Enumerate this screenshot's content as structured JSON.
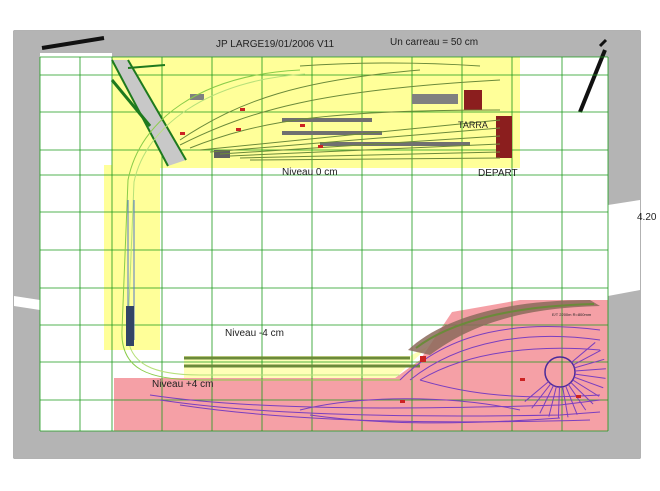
{
  "plan": {
    "title": "JP LARGE19/01/2006 V11",
    "scale_note": "Un carreau = 50 cm",
    "dimension": "4.20",
    "labels": {
      "level_0": "Niveau 0 cm",
      "level_minus4": "Niveau -4 cm",
      "level_plus4": "Niveau +4 cm",
      "depart": "DEPART",
      "building_mark": "TARRA",
      "small_note": "E/T 2200m  R=800mm"
    },
    "colors": {
      "room_wall": "#b4b4b4",
      "floor": "#ffffff",
      "level_0_zone": "#ffff99",
      "level_plus4_zone": "#f5a0a6",
      "grid": "#1a9a1a",
      "track_main": "#8acc4a",
      "track_secondary": "#7a3fbf",
      "road": "#c8c8c8",
      "road_edge": "#1e7a1e"
    }
  }
}
